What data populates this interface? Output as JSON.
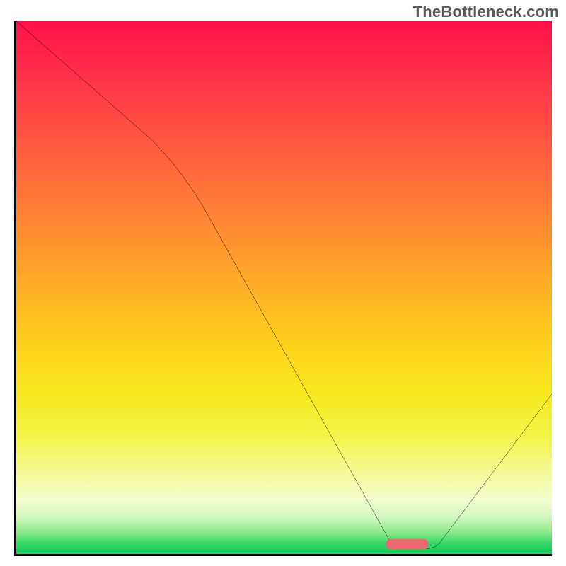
{
  "watermark": "TheBottleneck.com",
  "chart_data": {
    "type": "line",
    "title": "",
    "xlabel": "",
    "ylabel": "",
    "xlim": [
      0,
      100
    ],
    "ylim": [
      0,
      100
    ],
    "series": [
      {
        "name": "bottleneck-curve",
        "x": [
          0,
          25,
          70,
          76,
          79,
          100
        ],
        "values": [
          100,
          78,
          2,
          1,
          2,
          30
        ]
      }
    ],
    "marker": {
      "name": "optimal-range",
      "x_center": 73,
      "y": 1,
      "width": 8,
      "color": "#e86a6e"
    },
    "gradient_stops": [
      {
        "pos": 0,
        "color": "#ff1147"
      },
      {
        "pos": 22,
        "color": "#ff5640"
      },
      {
        "pos": 48,
        "color": "#ffa829"
      },
      {
        "pos": 70,
        "color": "#f8e91e"
      },
      {
        "pos": 90,
        "color": "#f3fccf"
      },
      {
        "pos": 100,
        "color": "#14c95a"
      }
    ]
  }
}
